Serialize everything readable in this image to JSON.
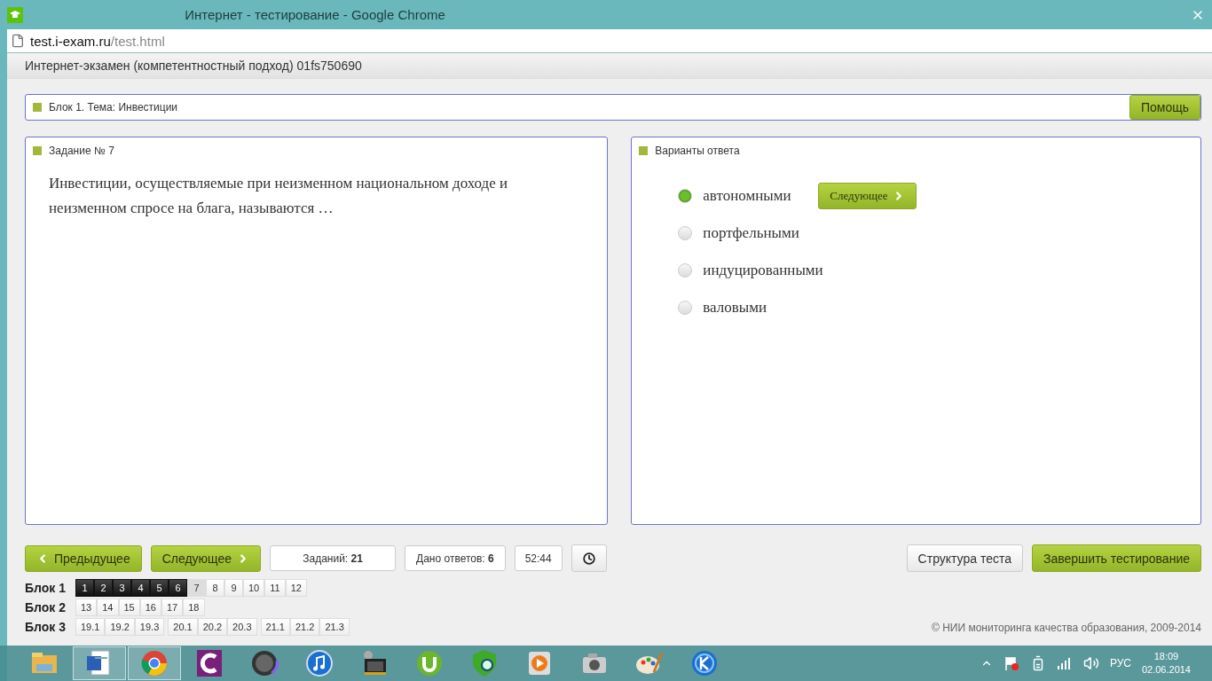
{
  "window": {
    "title": "Интернет - тестирование - Google Chrome"
  },
  "address": {
    "host": "test.i-exam.ru",
    "path": "/test.html"
  },
  "header": {
    "title": "Интернет-экзамен (компетентностный подход) 01fs750690"
  },
  "topic": {
    "label": "Блок 1. Тема: Инвестиции",
    "help_button": "Помощь"
  },
  "task": {
    "title": "Задание № 7",
    "text": "Инвестиции, осуществляемые при неизменном национальном доходе и неизменном спросе на блага, называются …"
  },
  "answers": {
    "title": "Варианты ответа",
    "next_button": "Следующее",
    "options": [
      {
        "label": "автономными",
        "selected": true
      },
      {
        "label": "портфельными",
        "selected": false
      },
      {
        "label": "индуцированными",
        "selected": false
      },
      {
        "label": "валовыми",
        "selected": false
      }
    ]
  },
  "nav": {
    "prev_button": "Предыдущее",
    "next_button": "Следующее",
    "tasks_label": "Заданий:",
    "tasks_count": "21",
    "answered_label": "Дано ответов:",
    "answered_count": "6",
    "timer": "52:44",
    "structure_button": "Структура теста",
    "finish_button": "Завершить тестирование"
  },
  "blocks": [
    {
      "label": "Блок 1",
      "groups": [
        [
          {
            "label": "1",
            "answered": true,
            "current": false
          },
          {
            "label": "2",
            "answered": true,
            "current": false
          },
          {
            "label": "3",
            "answered": true,
            "current": false
          },
          {
            "label": "4",
            "answered": true,
            "current": false
          },
          {
            "label": "5",
            "answered": true,
            "current": false
          },
          {
            "label": "6",
            "answered": true,
            "current": false
          },
          {
            "label": "7",
            "answered": false,
            "current": true
          },
          {
            "label": "8",
            "answered": false,
            "current": false
          },
          {
            "label": "9",
            "answered": false,
            "current": false
          },
          {
            "label": "10",
            "answered": false,
            "current": false
          },
          {
            "label": "11",
            "answered": false,
            "current": false
          },
          {
            "label": "12",
            "answered": false,
            "current": false
          }
        ]
      ]
    },
    {
      "label": "Блок 2",
      "groups": [
        [
          {
            "label": "13",
            "answered": false,
            "current": false
          },
          {
            "label": "14",
            "answered": false,
            "current": false
          },
          {
            "label": "15",
            "answered": false,
            "current": false
          },
          {
            "label": "16",
            "answered": false,
            "current": false
          },
          {
            "label": "17",
            "answered": false,
            "current": false
          },
          {
            "label": "18",
            "answered": false,
            "current": false
          }
        ]
      ]
    },
    {
      "label": "Блок 3",
      "groups": [
        [
          {
            "label": "19.1",
            "answered": false,
            "current": false
          },
          {
            "label": "19.2",
            "answered": false,
            "current": false
          },
          {
            "label": "19.3",
            "answered": false,
            "current": false
          }
        ],
        [
          {
            "label": "20.1",
            "answered": false,
            "current": false
          },
          {
            "label": "20.2",
            "answered": false,
            "current": false
          },
          {
            "label": "20.3",
            "answered": false,
            "current": false
          }
        ],
        [
          {
            "label": "21.1",
            "answered": false,
            "current": false
          },
          {
            "label": "21.2",
            "answered": false,
            "current": false
          },
          {
            "label": "21.3",
            "answered": false,
            "current": false
          }
        ]
      ]
    }
  ],
  "footer": "© НИИ мониторинга качества образования, 2009-2014",
  "taskbar": {
    "apps": [
      {
        "kind": "folder",
        "active": false
      },
      {
        "kind": "word",
        "active": true
      },
      {
        "kind": "chrome",
        "active": true
      },
      {
        "kind": "purple",
        "active": false
      },
      {
        "kind": "knob",
        "active": false
      },
      {
        "kind": "music",
        "active": false
      },
      {
        "kind": "film",
        "active": false
      },
      {
        "kind": "torrent",
        "active": false
      },
      {
        "kind": "shield",
        "active": false
      },
      {
        "kind": "play",
        "active": false
      },
      {
        "kind": "camera",
        "active": false
      },
      {
        "kind": "palette",
        "active": false
      },
      {
        "kind": "kcircle",
        "active": false
      }
    ],
    "lang": "РУС",
    "time": "18:09",
    "date": "02.06.2014"
  }
}
